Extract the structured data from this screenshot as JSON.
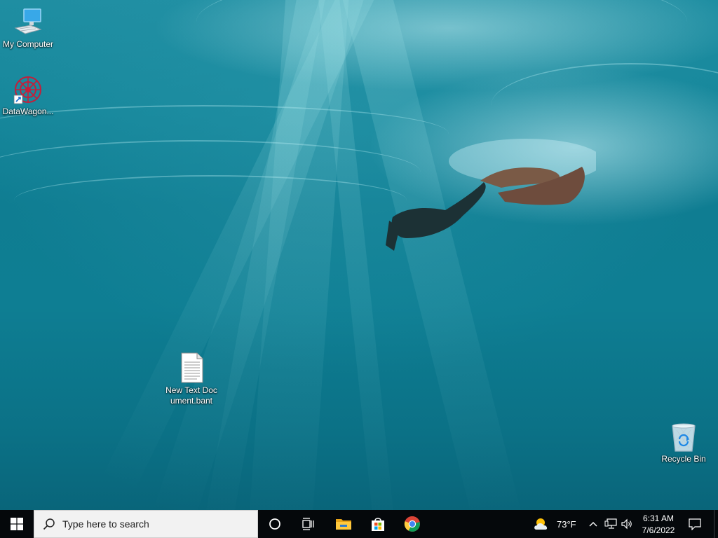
{
  "desktop": {
    "icons": [
      {
        "label": "My Computer",
        "icon": "computer-icon"
      },
      {
        "label": "DataWagon...",
        "icon": "datawagon-app-icon"
      },
      {
        "label": "New Text Document.bant",
        "icon": "text-document-icon"
      },
      {
        "label": "Recycle Bin",
        "icon": "recycle-bin-icon"
      }
    ]
  },
  "taskbar": {
    "search_placeholder": "Type here to search",
    "pinned": [
      "cortana-icon",
      "task-view-icon",
      "file-explorer-icon",
      "microsoft-store-icon",
      "chrome-icon"
    ],
    "weather": {
      "temperature": "73°F",
      "icon": "partly-cloudy-icon"
    },
    "clock": {
      "time": "6:31 AM",
      "date": "7/6/2022"
    }
  },
  "colors": {
    "taskbar_bg": "#05080b",
    "search_bg": "#f2f2f2",
    "water": "#0f7d92"
  }
}
